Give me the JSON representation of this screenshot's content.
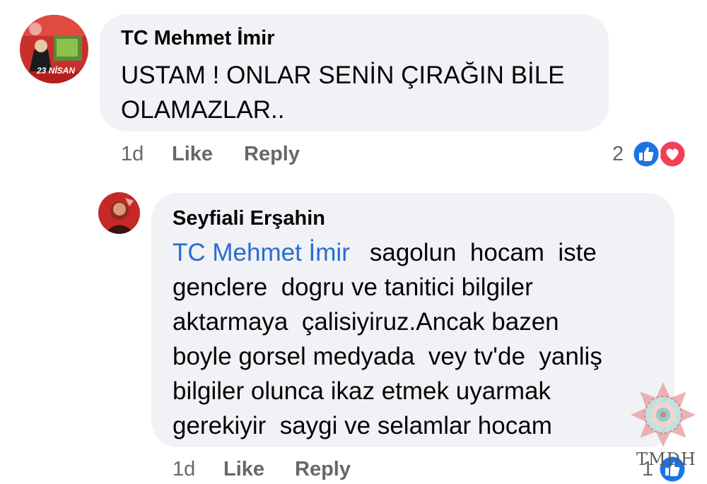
{
  "comments": [
    {
      "author": "TC Mehmet İmir",
      "avatar_badge": "23 NİSAN",
      "text_lines": [
        "USTAM ! ONLAR SENİN ÇIRAĞIN BİLE",
        "OLAMAZLAR.."
      ],
      "time": "1d",
      "like_label": "Like",
      "reply_label": "Reply",
      "reaction_count": "2",
      "reactions": [
        "like-icon",
        "love-icon"
      ]
    },
    {
      "author": "Seyfiali Erşahin",
      "mention": "TC Mehmet İmir",
      "first_line_rest": "sagolun  hocam  iste",
      "text_lines": [
        "genclere  dogru ve tanitici bilgiler",
        "aktarmaya  çalisiyiruz.Ancak bazen",
        "boyle gorsel medyada  vey tv'de  yanliş",
        "bilgiler olunca ikaz etmek uyarmak",
        "gerekiyir  saygi ve selamlar hocam"
      ],
      "time": "1d",
      "like_label": "Like",
      "reply_label": "Reply",
      "reaction_count": "1",
      "reactions": [
        "like-icon"
      ]
    }
  ],
  "watermark": {
    "text": "TMDH"
  },
  "colors": {
    "bubble": "#f0f2f5",
    "mention": "#2a6bd2",
    "meta": "#65676b",
    "like_blue": "#1b74e4",
    "love_red": "#f33e58"
  }
}
